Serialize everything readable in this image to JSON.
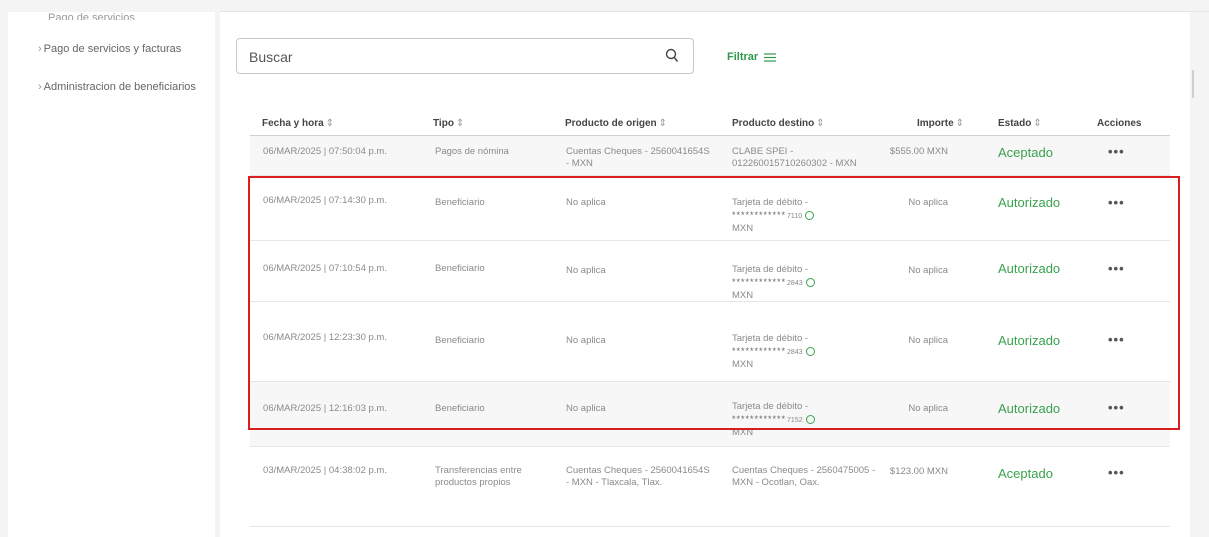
{
  "sidebar": {
    "top_cut": "Pago de servicios",
    "items": [
      {
        "label": "Pago de servicios y facturas"
      },
      {
        "label": "Administracion de beneficiarios"
      }
    ]
  },
  "search": {
    "placeholder": "Buscar",
    "icon": "search-icon"
  },
  "filter": {
    "label": "Filtrar",
    "icon": "filter-lines-icon"
  },
  "table": {
    "headers": [
      "Fecha y hora",
      "Tipo",
      "Producto de origen",
      "Producto destino",
      "Importe",
      "Estado",
      "Acciones"
    ],
    "sort_glyph": "⇕",
    "rows": [
      {
        "date": "06/MAR/2025 | 07:50:04 p.m.",
        "tipo": "Pagos de nómina",
        "origen": "Cuentas Cheques - 2560041654S - MXN",
        "destino": "CLABE SPEI - 012260015710260302 - MXN",
        "destino_mask": "",
        "destino_tail": "",
        "destino_suffix": "",
        "importe": "$555.00 MXN",
        "estado": "Aceptado",
        "acciones": "•••"
      },
      {
        "date": "06/MAR/2025 | 07:14:30 p.m.",
        "tipo": "Beneficiario",
        "origen": "No aplica",
        "destino": "Tarjeta de débito -",
        "destino_mask": "************",
        "destino_tail": "7110",
        "destino_suffix": "MXN",
        "importe": "No aplica",
        "estado": "Autorizado",
        "acciones": "•••"
      },
      {
        "date": "06/MAR/2025 | 07:10:54 p.m.",
        "tipo": "Beneficiario",
        "origen": "No aplica",
        "destino": "Tarjeta de débito -",
        "destino_mask": "************",
        "destino_tail": "2843",
        "destino_suffix": "MXN",
        "importe": "No aplica",
        "estado": "Autorizado",
        "acciones": "•••"
      },
      {
        "date": "06/MAR/2025 | 12:23:30 p.m.",
        "tipo": "Beneficiario",
        "origen": "No aplica",
        "destino": "Tarjeta de débito -",
        "destino_mask": "************",
        "destino_tail": "2843",
        "destino_suffix": "MXN",
        "importe": "No aplica",
        "estado": "Autorizado",
        "acciones": "•••"
      },
      {
        "date": "06/MAR/2025 | 12:16:03 p.m.",
        "tipo": "Beneficiario",
        "origen": "No aplica",
        "destino": "Tarjeta de débito -",
        "destino_mask": "************",
        "destino_tail": "7152",
        "destino_suffix": "MXN",
        "importe": "No aplica",
        "estado": "Autorizado",
        "acciones": "•••"
      },
      {
        "date": "03/MAR/2025 | 04:38:02 p.m.",
        "tipo": "Transferencias entre productos propios",
        "origen": "Cuentas Cheques - 2560041654S - MXN - Tlaxcala, Tlax.",
        "destino": "Cuentas Cheques - 2560475005 - MXN - Ocotlan, Oax.",
        "destino_mask": "",
        "destino_tail": "",
        "destino_suffix": "",
        "importe": "$123.00 MXN",
        "estado": "Aceptado",
        "acciones": "•••"
      }
    ]
  },
  "colors": {
    "accent_green": "#3aa14e",
    "highlight_red": "#d81e1e"
  }
}
